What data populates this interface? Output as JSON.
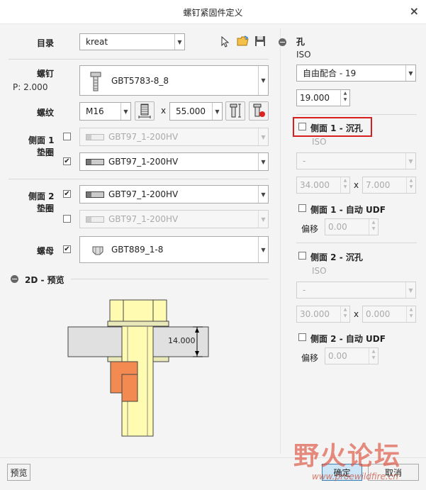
{
  "window": {
    "title": "螺钉紧固件定义",
    "close_glyph": "×"
  },
  "catalog": {
    "label": "目录",
    "value": "kreat"
  },
  "screw": {
    "label": "螺钉",
    "pitch": "P: 2.000",
    "value": "GBT5783-8_8"
  },
  "thread": {
    "label": "螺纹",
    "size": "M16",
    "times": "x",
    "length": "55.000"
  },
  "side1_washer": {
    "label_line1": "侧面 1",
    "label_line2": "垫圈",
    "row1": {
      "checked": false,
      "value": "GBT97_1-200HV"
    },
    "row2": {
      "checked": true,
      "value": "GBT97_1-200HV"
    }
  },
  "side2_washer": {
    "label_line1": "侧面 2",
    "label_line2": "垫圈",
    "row1": {
      "checked": true,
      "value": "GBT97_1-200HV"
    },
    "row2": {
      "checked": false,
      "value": "GBT97_1-200HV"
    }
  },
  "nut": {
    "label": "螺母",
    "checked": true,
    "value": "GBT889_1-8"
  },
  "preview2d": {
    "label": "2D - 预览",
    "dimension": "14.000"
  },
  "hole": {
    "label": "孔",
    "standard": "ISO",
    "fit": "自由配合 - 19",
    "diameter": "19.000"
  },
  "side1_counterbore": {
    "label": "侧面 1 - 沉孔",
    "checked": false,
    "standard": "ISO",
    "type": "-",
    "dia": "34.000",
    "times": "x",
    "depth": "7.000"
  },
  "side1_udf": {
    "label": "侧面 1 - 自动 UDF",
    "checked": false,
    "offset_label": "偏移",
    "offset": "0.00"
  },
  "side2_counterbore": {
    "label": "侧面 2 - 沉孔",
    "checked": false,
    "standard": "ISO",
    "type": "-",
    "dia": "30.000",
    "times": "x",
    "depth": "0.000"
  },
  "side2_udf": {
    "label": "侧面 2 - 自动 UDF",
    "checked": false,
    "offset_label": "偏移",
    "offset": "0.00"
  },
  "footer": {
    "preview": "预览",
    "ok": "确定",
    "cancel": "取消"
  },
  "watermark": {
    "text": "野火论坛",
    "url": "www.proewildfire.cn"
  },
  "colors": {
    "highlight": "#d62020",
    "bolt": "#fffbb0",
    "nut": "#f28a52",
    "plate": "#e0e0e0",
    "washer": "#e8e8b8"
  }
}
